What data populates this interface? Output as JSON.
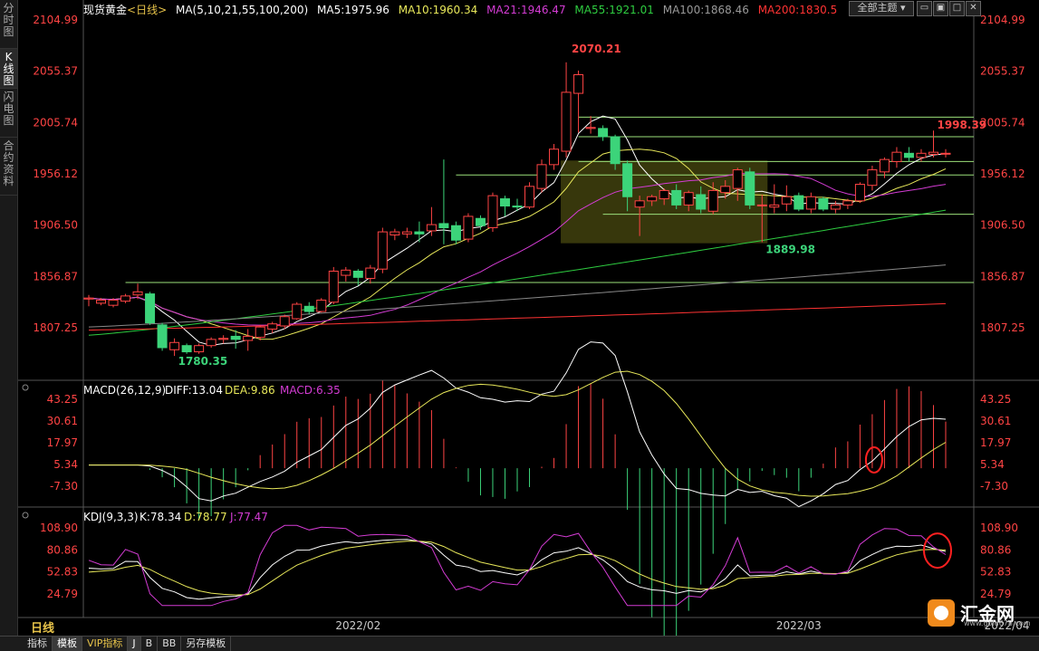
{
  "left_tabs": [
    "分时图",
    "K线图",
    "闪电图",
    "合约资料"
  ],
  "header": {
    "symbol": "现货黄金",
    "period": "<日线>",
    "ma_label": "MA(5,10,21,55,100,200)",
    "ma5": "MA5:1975.96",
    "ma10": "MA10:1960.34",
    "ma21": "MA21:1946.47",
    "ma55": "MA55:1921.01",
    "ma100": "MA100:1868.46",
    "ma200": "MA200:1830.5"
  },
  "theme_button": "全部主题",
  "period_badge": "日线",
  "macd_header": {
    "label": "MACD(26,12,9)",
    "diff": "DIFF:13.04",
    "dea": "DEA:9.86",
    "macd": "MACD:6.35"
  },
  "kdj_header": {
    "label": "KDJ(9,3,3)",
    "k": "K:78.34",
    "d": "D:78.77",
    "j": "J:77.47"
  },
  "bottom_tabs": [
    "指标",
    "模板",
    "VIP指标",
    "J",
    "B",
    "BB",
    "另存模板"
  ],
  "logo": {
    "text": "汇金网",
    "url": "www.gold678.com"
  },
  "colors": {
    "up": "#ff4444",
    "down": "#3cd47a",
    "ma5": "#ffffff",
    "ma10": "#e8e85a",
    "ma21": "#d43cd4",
    "ma55": "#2ecc40",
    "ma100": "#888888",
    "ma200": "#ff3333",
    "hline": "#9be07a",
    "box": "#4a4a10",
    "marker": "#ff2020"
  },
  "chart_data": {
    "type": "candlestick",
    "price_ticks": [
      "2104.99",
      "2055.37",
      "2005.74",
      "1956.12",
      "1906.50",
      "1856.87",
      "1807.25"
    ],
    "macd_ticks": [
      "43.25",
      "30.61",
      "17.97",
      "5.34",
      "-7.30"
    ],
    "kdj_ticks": [
      "108.90",
      "80.86",
      "52.83",
      "24.79"
    ],
    "x_labels": [
      "2022/02",
      "2022/03",
      "2022/04"
    ],
    "annotations": {
      "high": "2070.21",
      "low": "1780.35",
      "range_low": "1889.98",
      "recent_high": "1998.39"
    },
    "levels": [
      2011,
      1992,
      1968,
      1955,
      1917,
      1851
    ],
    "highlight_box": {
      "from_index": 39,
      "to_index": 55,
      "low": 1889,
      "high": 1969
    },
    "candles": [
      [
        1835,
        1836,
        1828,
        1839
      ],
      [
        1831,
        1834,
        1829,
        1836
      ],
      [
        1829,
        1834,
        1827,
        1836
      ],
      [
        1833,
        1838,
        1831,
        1840
      ],
      [
        1839,
        1842,
        1835,
        1850
      ],
      [
        1840,
        1812,
        1810,
        1842
      ],
      [
        1810,
        1788,
        1785,
        1812
      ],
      [
        1786,
        1793,
        1780,
        1797
      ],
      [
        1790,
        1784,
        1782,
        1792
      ],
      [
        1784,
        1790,
        1782,
        1792
      ],
      [
        1790,
        1796,
        1788,
        1798
      ],
      [
        1796,
        1797,
        1792,
        1800
      ],
      [
        1799,
        1796,
        1787,
        1805
      ],
      [
        1795,
        1799,
        1785,
        1806
      ],
      [
        1798,
        1808,
        1795,
        1810
      ],
      [
        1806,
        1811,
        1802,
        1813
      ],
      [
        1809,
        1818,
        1806,
        1820
      ],
      [
        1816,
        1830,
        1815,
        1832
      ],
      [
        1828,
        1823,
        1820,
        1832
      ],
      [
        1823,
        1834,
        1822,
        1836
      ],
      [
        1832,
        1862,
        1830,
        1866
      ],
      [
        1858,
        1863,
        1852,
        1866
      ],
      [
        1862,
        1856,
        1848,
        1864
      ],
      [
        1855,
        1865,
        1850,
        1868
      ],
      [
        1864,
        1900,
        1860,
        1904
      ],
      [
        1897,
        1900,
        1892,
        1903
      ],
      [
        1898,
        1900,
        1894,
        1904
      ],
      [
        1900,
        1898,
        1890,
        1910
      ],
      [
        1901,
        1907,
        1896,
        1924
      ],
      [
        1908,
        1904,
        1888,
        1970
      ],
      [
        1906,
        1892,
        1888,
        1910
      ],
      [
        1893,
        1915,
        1890,
        1918
      ],
      [
        1913,
        1906,
        1902,
        1916
      ],
      [
        1904,
        1935,
        1900,
        1938
      ],
      [
        1932,
        1925,
        1915,
        1935
      ],
      [
        1925,
        1924,
        1920,
        1932
      ],
      [
        1924,
        1944,
        1922,
        1948
      ],
      [
        1942,
        1965,
        1938,
        1970
      ],
      [
        1965,
        1980,
        1960,
        1985
      ],
      [
        1978,
        2035,
        1972,
        2064
      ],
      [
        2034,
        2052,
        1996,
        2056
      ],
      [
        2000,
        2001,
        1995,
        2012
      ],
      [
        2000,
        1992,
        1988,
        2003
      ],
      [
        1992,
        1966,
        1960,
        1994
      ],
      [
        1966,
        1934,
        1920,
        1969
      ],
      [
        1924,
        1930,
        1896,
        1935
      ],
      [
        1930,
        1934,
        1925,
        1936
      ],
      [
        1932,
        1940,
        1926,
        1942
      ],
      [
        1940,
        1926,
        1922,
        1946
      ],
      [
        1926,
        1938,
        1920,
        1940
      ],
      [
        1936,
        1922,
        1918,
        1944
      ],
      [
        1920,
        1940,
        1917,
        1948
      ],
      [
        1938,
        1944,
        1932,
        1950
      ],
      [
        1942,
        1960,
        1930,
        1962
      ],
      [
        1958,
        1926,
        1922,
        1962
      ],
      [
        1926,
        1926,
        1890,
        1936
      ],
      [
        1924,
        1926,
        1918,
        1946
      ],
      [
        1927,
        1934,
        1920,
        1945
      ],
      [
        1935,
        1922,
        1920,
        1938
      ],
      [
        1922,
        1934,
        1918,
        1938
      ],
      [
        1932,
        1922,
        1920,
        1934
      ],
      [
        1922,
        1926,
        1918,
        1930
      ],
      [
        1926,
        1930,
        1922,
        1932
      ],
      [
        1930,
        1946,
        1928,
        1948
      ],
      [
        1945,
        1960,
        1940,
        1964
      ],
      [
        1958,
        1970,
        1952,
        1972
      ],
      [
        1968,
        1977,
        1962,
        1982
      ],
      [
        1976,
        1972,
        1968,
        1982
      ],
      [
        1972,
        1976,
        1968,
        1980
      ],
      [
        1975,
        1977,
        1972,
        1998
      ],
      [
        1976,
        1976,
        1972,
        1980
      ]
    ]
  }
}
